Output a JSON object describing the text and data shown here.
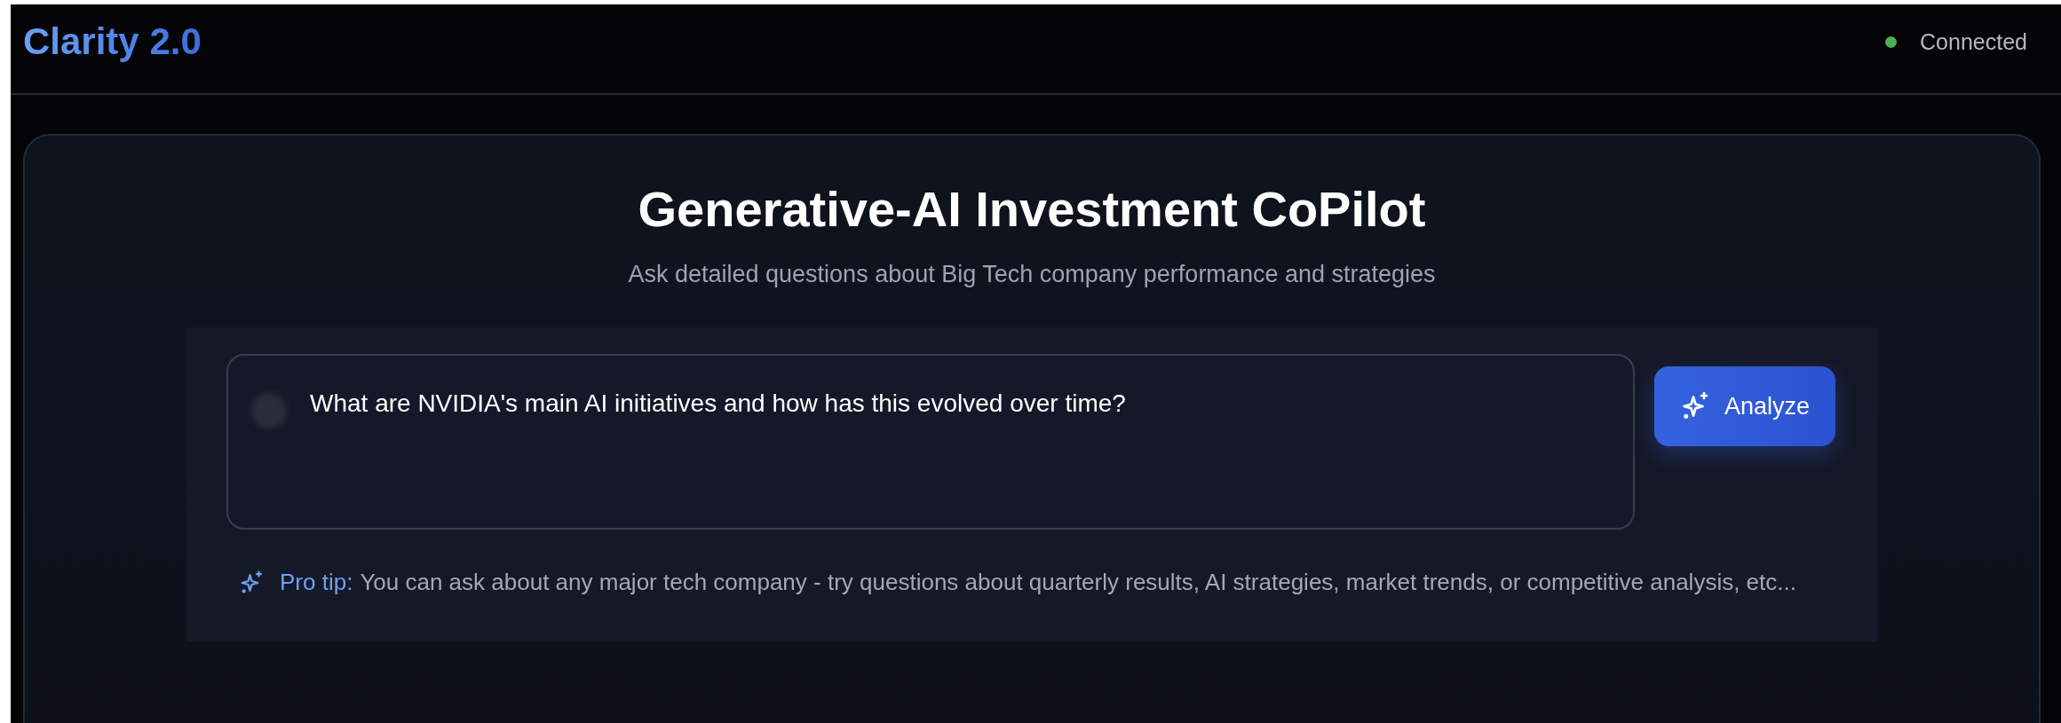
{
  "header": {
    "logo": "Clarity 2.0",
    "status": {
      "label": "Connected",
      "color": "#4caf50"
    }
  },
  "hero": {
    "title": "Generative-AI Investment CoPilot",
    "subtitle": "Ask detailed questions about Big Tech company performance and strategies"
  },
  "query": {
    "value": "What are NVIDIA's main AI initiatives and how has this evolved over time?",
    "button": "Analyze"
  },
  "tip": {
    "label": "Pro tip:",
    "text": "You can ask about any major tech company - try questions about quarterly results, AI strategies, market trends, or competitive analysis, etc..."
  }
}
